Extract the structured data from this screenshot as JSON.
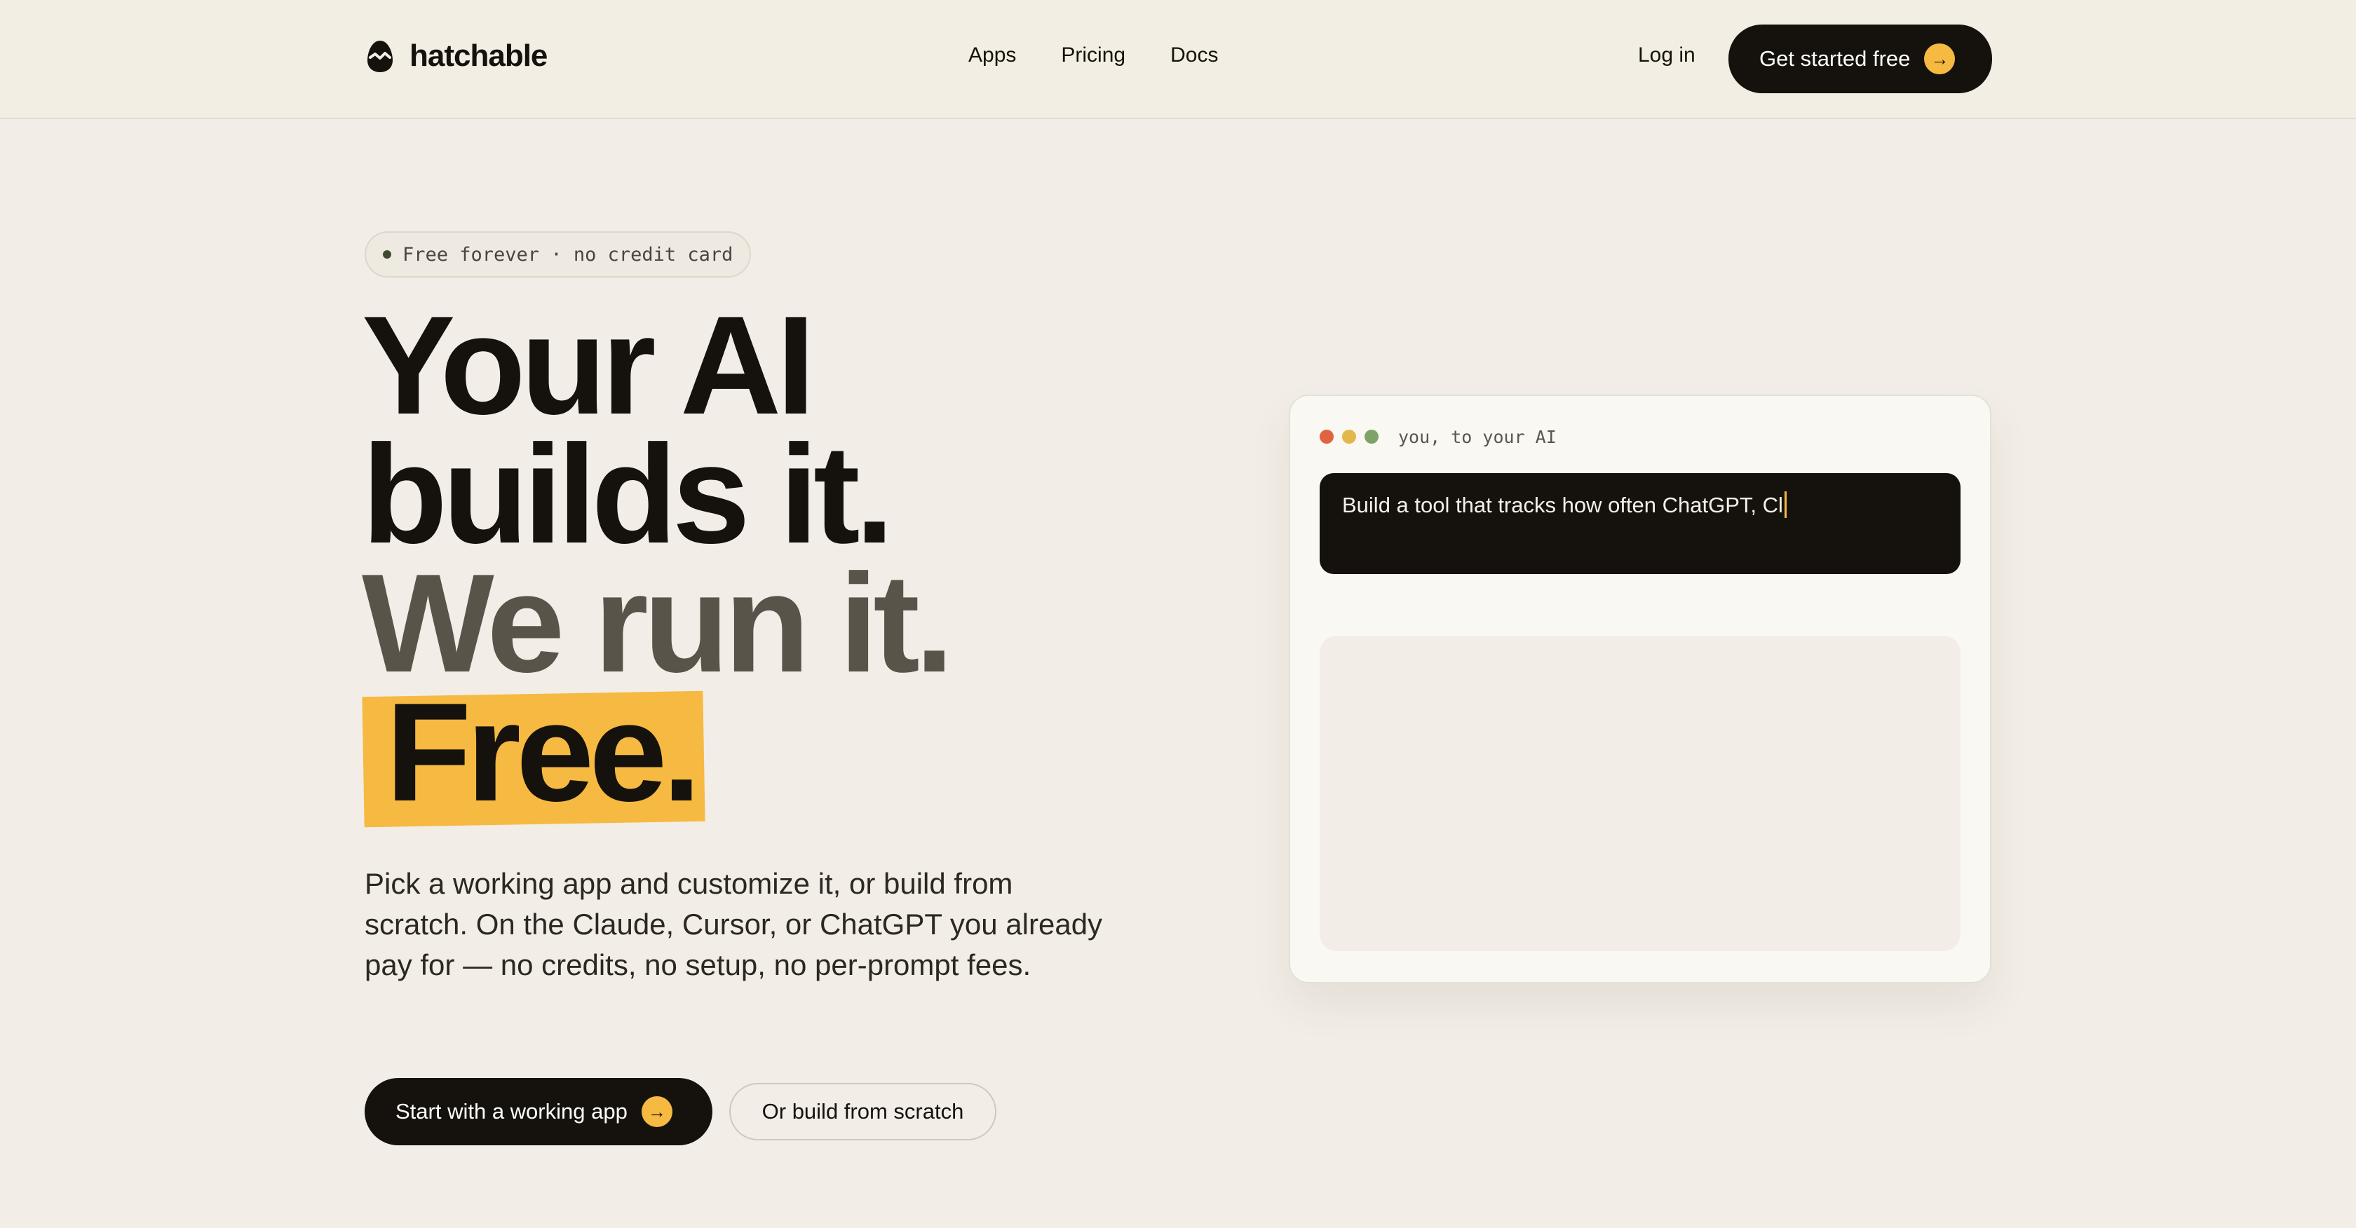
{
  "nav": {
    "brand": "hatchable",
    "links": [
      "Apps",
      "Pricing",
      "Docs"
    ],
    "login": "Log in",
    "cta": "Get started free",
    "cta_arrow": "→"
  },
  "hero": {
    "badge": "Free forever · no credit card",
    "headline": [
      "Your AI",
      "builds it.",
      "We run it.",
      "Free."
    ],
    "subtext": "Pick a working app and customize it, or build from scratch. On the Claude, Cursor, or ChatGPT you already pay for — no credits, no setup, no per-prompt fees.",
    "cta_primary": "Start with a working app",
    "cta_primary_arrow": "→",
    "cta_secondary": "Or build from scratch"
  },
  "demo": {
    "label": "you, to your AI",
    "prompt_text": "Build a tool that tracks how often ChatGPT, Cl",
    "window_dots": [
      "#e06343",
      "#e3b84a",
      "#7ea36a"
    ]
  },
  "colors": {
    "accent": "#f6b941",
    "ink": "#15120d",
    "background": "#f2eee7"
  }
}
